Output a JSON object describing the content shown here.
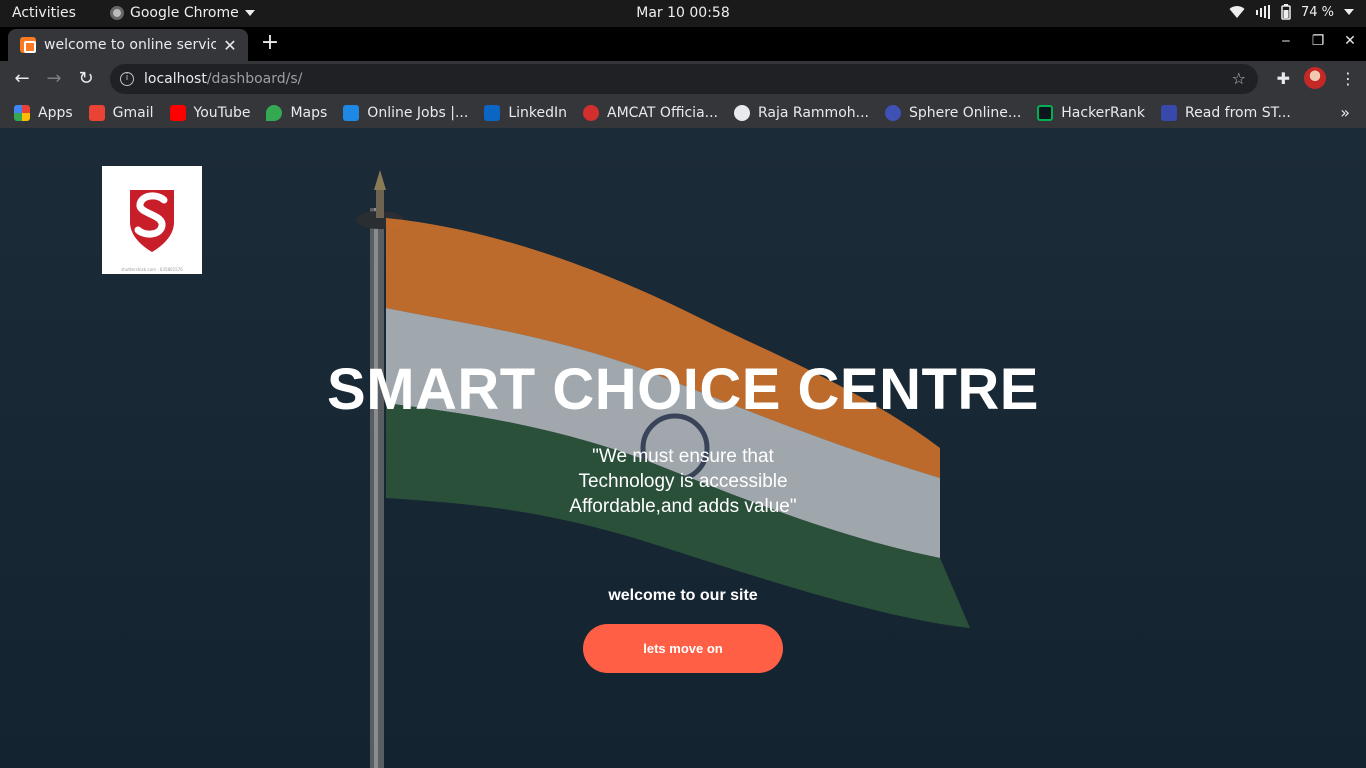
{
  "system_bar": {
    "activities": "Activities",
    "app_name": "Google Chrome",
    "datetime": "Mar 10  00:58",
    "battery": "74 %"
  },
  "browser": {
    "tab_title": "welcome to online service",
    "url_host": "localhost",
    "url_path": "/dashboard/s/",
    "bookmarks": [
      {
        "label": "Apps",
        "icon": "apps-grid-icon",
        "color": "#e8453c"
      },
      {
        "label": "Gmail",
        "icon": "gmail-icon",
        "color": "#ea4335"
      },
      {
        "label": "YouTube",
        "icon": "youtube-icon",
        "color": "#ff0000"
      },
      {
        "label": "Maps",
        "icon": "maps-icon",
        "color": "#34a853"
      },
      {
        "label": "Online Jobs |...",
        "icon": "online-jobs-icon",
        "color": "#1e88e5"
      },
      {
        "label": "LinkedIn",
        "icon": "linkedin-icon",
        "color": "#0a66c2"
      },
      {
        "label": "AMCAT Officia...",
        "icon": "amcat-icon",
        "color": "#d32f2f"
      },
      {
        "label": "Raja Rammoh...",
        "icon": "globe-icon",
        "color": "#e8eaed"
      },
      {
        "label": "Sphere Online...",
        "icon": "sphere-icon",
        "color": "#3f51b5"
      },
      {
        "label": "HackerRank",
        "icon": "hackerrank-icon",
        "color": "#00b050"
      },
      {
        "label": "Read from ST...",
        "icon": "read-icon",
        "color": "#3949ab"
      }
    ]
  },
  "page": {
    "title": "SMART CHOICE CENTRE",
    "quote_line1": "\"We must ensure that",
    "quote_line2": "Technology is accessible",
    "quote_line3": "Affordable,and adds value\"",
    "welcome": "welcome to our site",
    "cta_label": "lets move on",
    "cta_color": "#ff5f45",
    "logo_caption": "shutterstock.com · 635801576"
  }
}
